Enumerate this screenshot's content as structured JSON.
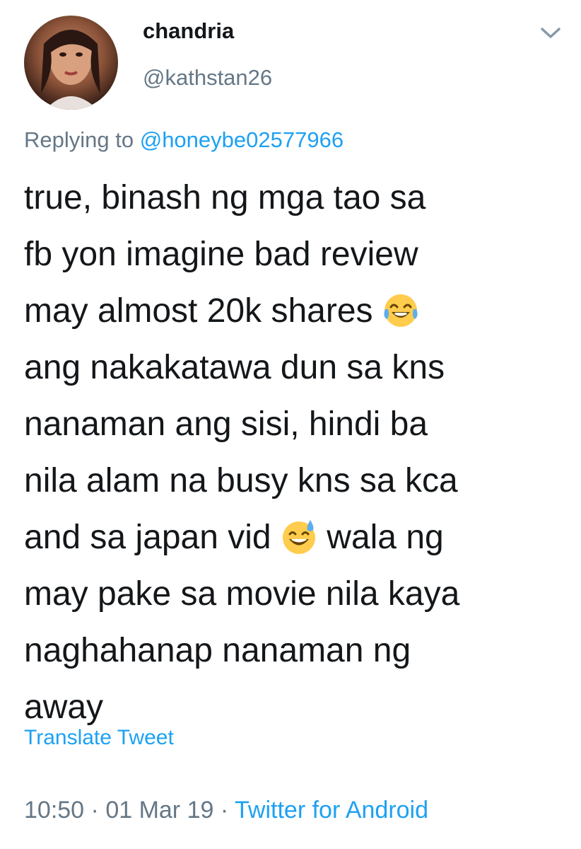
{
  "tweet": {
    "author": {
      "display_name": "chandria",
      "handle": "@kathstan26",
      "avatar_icon": "profile-photo"
    },
    "menu_icon": "chevron-down-icon",
    "reply_label": "Replying to ",
    "reply_to": "@honeybe02577966",
    "lines": [
      {
        "text": "true, binash ng mga tao sa"
      },
      {
        "text": "fb yon imagine bad review"
      },
      {
        "text": "may almost 20k shares ",
        "emoji": "face-with-tears-of-joy"
      },
      {
        "text": "ang nakakatawa dun sa kns"
      },
      {
        "text": "nanaman ang sisi, hindi ba"
      },
      {
        "text": "nila alam na busy kns sa kca"
      },
      {
        "text": "and sa japan vid ",
        "emoji": "grinning-face-with-sweat",
        "after": "  wala ng"
      },
      {
        "text": "may pake sa movie nila kaya"
      },
      {
        "text": "naghahanap nanaman ng"
      },
      {
        "text": "away"
      }
    ],
    "translate_label": "Translate Tweet",
    "time": "10:50",
    "separator": " · ",
    "date": "01 Mar 19",
    "source": "Twitter for Android"
  },
  "colors": {
    "text": "#14171a",
    "secondary": "#657786",
    "link": "#1da1f2"
  }
}
